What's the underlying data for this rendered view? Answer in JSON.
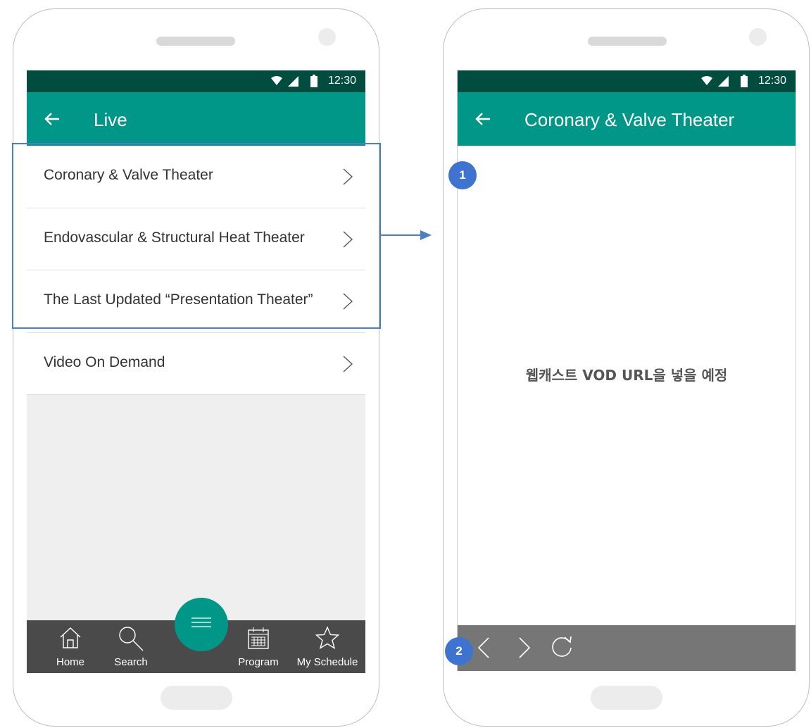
{
  "left_phone": {
    "status_time": "12:30",
    "appbar": {
      "title": "Live",
      "back_icon": "arrow-left-icon"
    },
    "list_items": [
      {
        "label": "Coronary & Valve Theater",
        "icon": "chevron-right-icon"
      },
      {
        "label": "Endovascular & Structural Heat Theater",
        "icon": "chevron-right-icon"
      },
      {
        "label": "The Last Updated “Presentation Theater”",
        "icon": "chevron-right-icon"
      },
      {
        "label": "Video On Demand",
        "icon": "chevron-right-icon"
      }
    ],
    "bottom_nav": [
      {
        "label": "Home",
        "icon": "home-icon"
      },
      {
        "label": "Search",
        "icon": "search-icon"
      },
      {
        "label": "Program",
        "icon": "calendar-icon"
      },
      {
        "label": "My Schedule",
        "icon": "star-icon"
      }
    ],
    "fab_icon": "menu-icon"
  },
  "right_phone": {
    "status_time": "12:30",
    "appbar": {
      "title": "Coronary & Valve Theater",
      "back_icon": "arrow-left-icon"
    },
    "webview_text": "웹캐스트 VOD URL을 넣을 예정",
    "toolbar": [
      "chevron-left-icon",
      "chevron-right-icon",
      "refresh-icon"
    ]
  },
  "annotations": {
    "badge_1": "1",
    "badge_2": "2"
  },
  "colors": {
    "status_bar": "#004d40",
    "app_bar": "#009688",
    "bottom_nav": "#4a4a4a",
    "browser_toolbar": "#767676",
    "highlight": "#4a7ec7",
    "badge": "#3e74cf"
  }
}
